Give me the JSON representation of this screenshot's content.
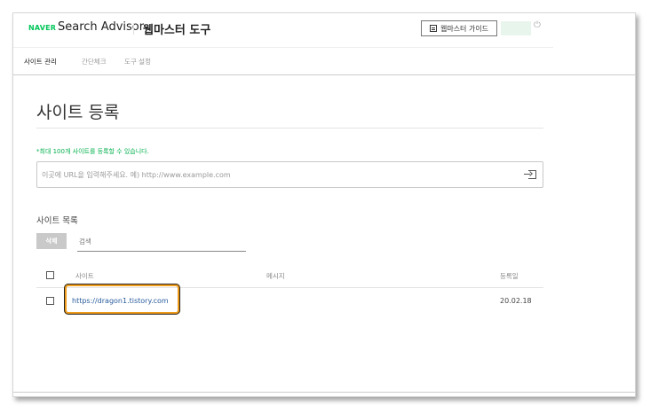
{
  "header": {
    "brand": "NAVER",
    "product": "Search Advisor",
    "title": "웹마스터 도구",
    "guide_button": "웹마스터 가이드"
  },
  "tabs": [
    {
      "label": "사이트 관리",
      "active": true
    },
    {
      "label": "간단체크",
      "active": false
    },
    {
      "label": "도구 설정",
      "active": false
    }
  ],
  "main": {
    "title": "사이트 등록",
    "notice": "*최대 100개 사이트를 등록할 수 있습니다.",
    "url_placeholder": "이곳에 URL을 입력해주세요. 예) http://www.example.com"
  },
  "list": {
    "title": "사이트 목록",
    "delete_label": "삭제",
    "search_placeholder": "검색",
    "columns": [
      "사이트",
      "메시지",
      "등록일"
    ],
    "rows": [
      {
        "site": "https://dragon1.tistory.com",
        "message": "",
        "date": "20.02.18"
      }
    ]
  },
  "colors": {
    "brand_green": "#03c75a",
    "highlight_orange": "#f09c1b",
    "link_blue": "#2a5d9e"
  }
}
